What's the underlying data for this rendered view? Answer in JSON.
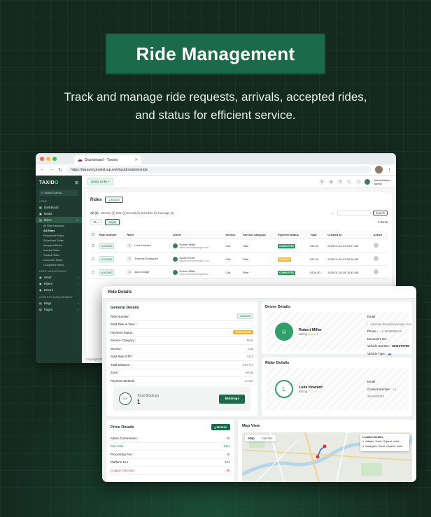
{
  "banner": {
    "title": "Ride Management"
  },
  "subtitle": {
    "line1": "Track and manage ride requests, arrivals, accepted rides,",
    "line2": "and status for efficient service."
  },
  "browser": {
    "tab_title": "Dashboard - Taxido",
    "url": "https://laravel.pixelstrap.net/taxido/admin/ride",
    "brand_a": "TAXID",
    "brand_b": "O",
    "search_menu": "Search Menu",
    "nav": {
      "home": "HOME",
      "dashboard": "Dashboard",
      "media": "Media",
      "rides": "Rides",
      "sub": [
        "All Ride Requests",
        "All Rides",
        "Requested Rides",
        "Scheduled Rides",
        "Accepted Rides",
        "Arrived Rides",
        "Started Rides",
        "Cancelled Rides",
        "Completed Rides"
      ],
      "user_mgmt": "USER MANAGEMENT",
      "users": "Users",
      "riders": "Riders",
      "drivers": "Drivers",
      "content_mgmt": "CONTENT MANAGEMENT",
      "blogs": "Blogs",
      "pages": "Pages"
    },
    "quick_links": "Quick Links +",
    "admin_name": "Administrator",
    "admin_role": "Admin",
    "rides_title": "Rides",
    "export": "Export",
    "filters": {
      "all": "All (3)",
      "rest": "Intercity (0)  Ride (3)  Rental (0)  Schedule (0)  Package (0)"
    },
    "search_btn": "Search",
    "per_page": "15",
    "apply": "Apply",
    "items": "3 Items",
    "columns": [
      "Ride Number",
      "Rider",
      "Driver",
      "Service",
      "Service Category",
      "Payment Status",
      "Total",
      "Created At",
      "Action"
    ],
    "rows": [
      {
        "number": "#100006",
        "initial": "L",
        "rider": "Luke Howard",
        "driver": "Robert Miller",
        "email": "robert.driver@example.com",
        "service": "Cab",
        "category": "Ride",
        "status": "COMPLETED",
        "status_color": "#1f9d5c",
        "total": "$19.00",
        "created": "2025-01-28 04:24:07 AM"
      },
      {
        "number": "#100001",
        "initial": "T",
        "rider": "Thomas Rodriguez",
        "driver": "Daniel Scott",
        "email": "daniel.driver@example.com",
        "service": "Cab",
        "category": "Ride",
        "status": "PENDING",
        "status_color": "#f5b32a",
        "total": "$47.00",
        "created": "2025-01-28 03:28:16 AM"
      },
      {
        "number": "#100002",
        "initial": "J",
        "rider": "Jack Dodge",
        "driver": "Robert Miller",
        "email": "robert.driver@example.com",
        "service": "Cab",
        "category": "Ride",
        "status": "COMPLETED",
        "status_color": "#1f9d5c",
        "total": "$134.00",
        "created": "2025-01-28 06:24:33 AM"
      }
    ],
    "copyright": "Copyright 20"
  },
  "detail": {
    "title": "Ride Details",
    "general": {
      "title": "General Details",
      "items": [
        {
          "k": "Ride Number :",
          "v": "#100000",
          "type": "badge"
        },
        {
          "k": "Start Date & Time :",
          "v": ""
        },
        {
          "k": "Payment Status :",
          "v": "COMPLETED",
          "type": "status"
        },
        {
          "k": "Service Category :",
          "v": "Ride"
        },
        {
          "k": "Service :",
          "v": "Cab"
        },
        {
          "k": "Start Ride OTP :",
          "v": "4113"
        },
        {
          "k": "Total Distance :",
          "v": "6.87 km"
        },
        {
          "k": "Zone :",
          "v": "World"
        },
        {
          "k": "Payment Method :",
          "v": "CASH"
        }
      ],
      "bid_label": "Total Biddings",
      "bid_count": "1",
      "bid_button": "Biddings"
    },
    "driver": {
      "title": "Driver Details",
      "name": "Robert Miller",
      "rating_label": "Rating",
      "stars": "★★★★☆",
      "email_k": "Email :",
      "email_v": "robertmi.driver@example.com",
      "phone_k": "Phone :",
      "phone_v": "+1 3509099014",
      "doc_k": "Document No:",
      "doc_v": "",
      "vehicle_k": "Vehicle Number:",
      "vehicle_v": "MH12TS789",
      "type_k": "Vehicle Type:"
    },
    "rider": {
      "title": "Rider Details",
      "initial": "L",
      "name": "Luke Howard",
      "rating_label": "Rating",
      "stars": "☆☆☆☆☆",
      "email_k": "Email :",
      "email_v": "",
      "contact_k": "Contact Number:",
      "contact_v": "+1 3549180314"
    },
    "price": {
      "title": "Price Details",
      "invoice": "Invoice",
      "items": [
        {
          "k": "Admin Commission :",
          "v": "$0"
        },
        {
          "k": "Sub Total :",
          "v": "$114",
          "green": true
        },
        {
          "k": "Processing Fee :",
          "v": "$0"
        },
        {
          "k": "Platform Fee :",
          "v": "$10"
        },
        {
          "k": "Coupon Discount :",
          "v": "-$0",
          "red": true
        }
      ]
    },
    "map": {
      "title": "Map View",
      "tab_map": "Map",
      "tab_sat": "Satellite",
      "loc_title": "Location Details",
      "loc1": "Adajan, Surat, Gujarat, India",
      "loc2": "Katargam, Surat, Gujarat, India"
    }
  }
}
